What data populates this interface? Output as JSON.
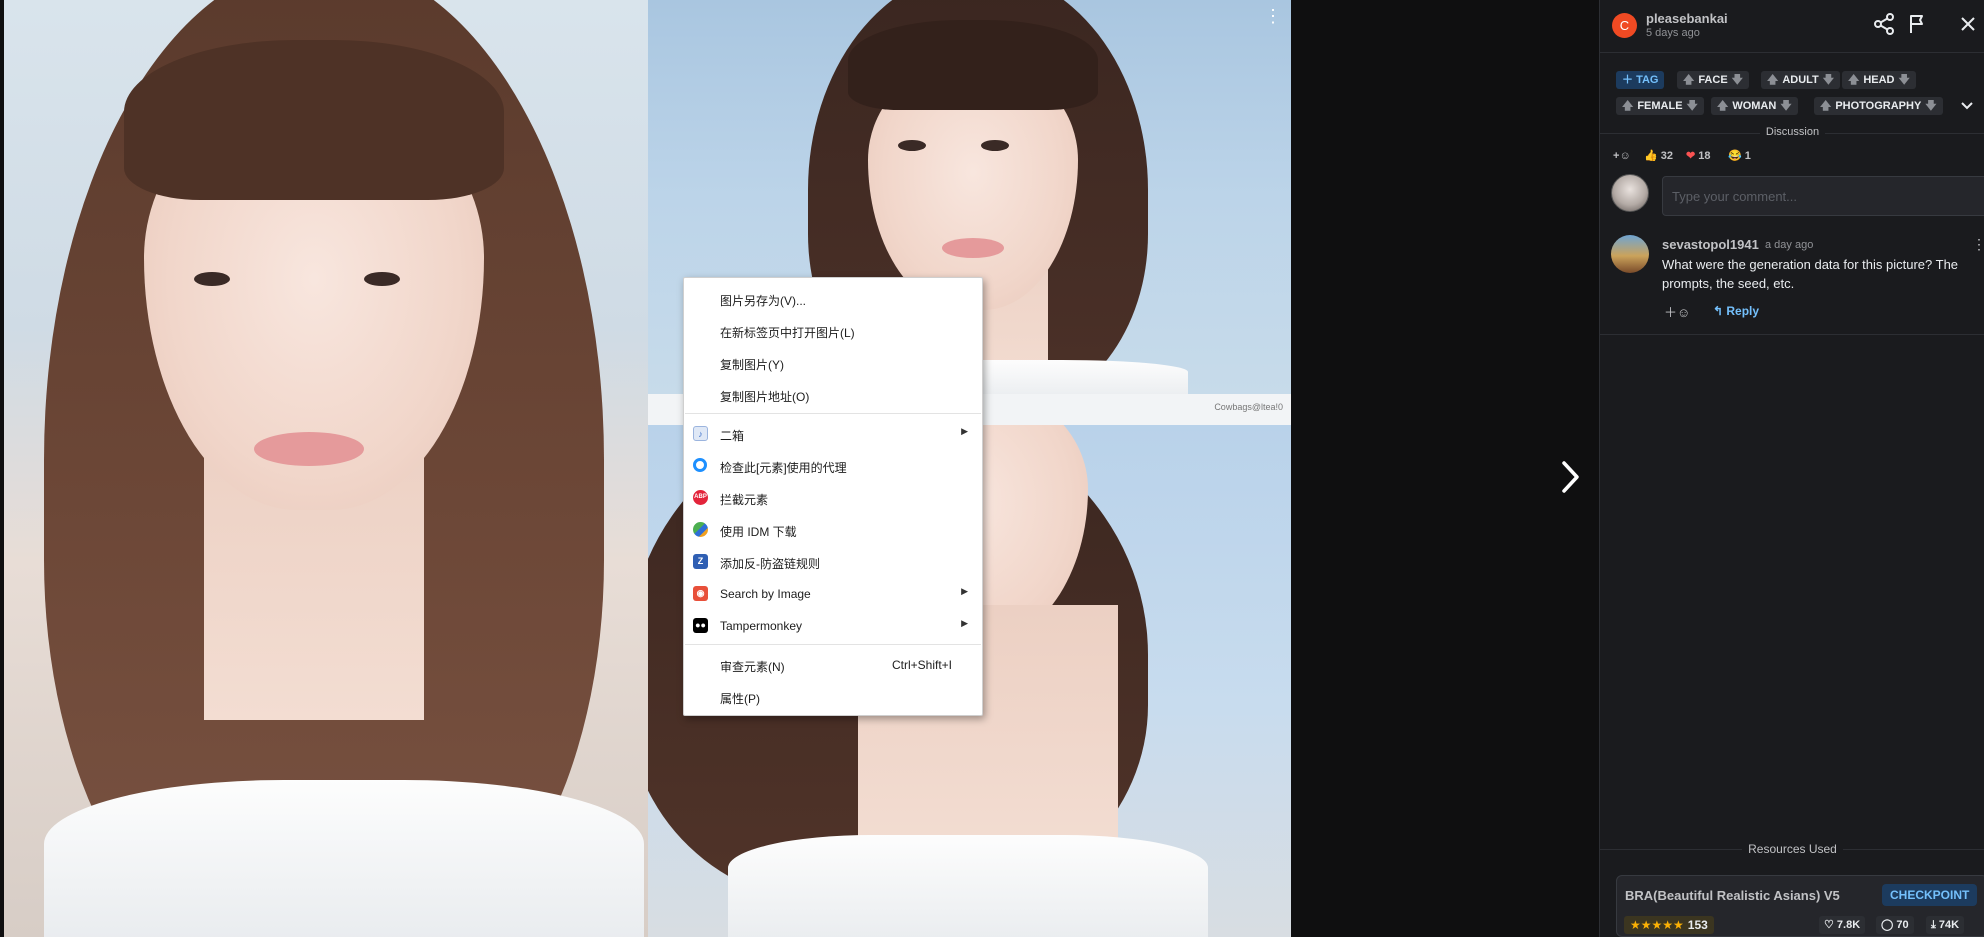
{
  "images": {
    "watermark": "Cowbags@ltea!0"
  },
  "context_menu": {
    "items": [
      {
        "label": "图片另存为(V)...",
        "icon": "",
        "submenu": false
      },
      {
        "label": "在新标签页中打开图片(L)",
        "icon": "",
        "submenu": false
      },
      {
        "label": "复制图片(Y)",
        "icon": "",
        "submenu": false
      },
      {
        "label": "复制图片地址(O)",
        "icon": "",
        "submenu": false
      },
      {
        "label": "二箱",
        "icon": "erxiang-icon",
        "submenu": true
      },
      {
        "label": "检查此[元素]使用的代理",
        "icon": "proxy-circle-icon",
        "submenu": false
      },
      {
        "label": "拦截元素",
        "icon": "adblock-plus-icon",
        "icon_text": "ABP",
        "submenu": false
      },
      {
        "label": "使用 IDM 下载",
        "icon": "idm-icon",
        "submenu": false
      },
      {
        "label": "添加反-防盗链规则",
        "icon": "anti-hotlink-icon",
        "submenu": false
      },
      {
        "label": "Search by Image",
        "icon": "search-by-image-icon",
        "submenu": true
      },
      {
        "label": "Tampermonkey",
        "icon": "tampermonkey-icon",
        "submenu": true
      },
      {
        "label": "审查元素(N)",
        "shortcut": "Ctrl+Shift+I",
        "icon": "",
        "submenu": false
      },
      {
        "label": "属性(P)",
        "icon": "",
        "submenu": false
      }
    ]
  },
  "post": {
    "avatar_letter": "C",
    "username": "pleasebankai",
    "time": "5 days ago"
  },
  "tags": {
    "add_label": "TAG",
    "items": [
      "FACE",
      "ADULT",
      "HEAD",
      "FEMALE",
      "WOMAN",
      "PHOTOGRAPHY"
    ]
  },
  "discussion": {
    "label": "Discussion",
    "reactions": [
      {
        "emoji": "👍",
        "count": "32"
      },
      {
        "emoji": "❤",
        "count": "18"
      },
      {
        "emoji": "😂",
        "count": "1"
      }
    ],
    "comment_placeholder": "Type your comment...",
    "comments": [
      {
        "username": "sevastopol1941",
        "time": "a day ago",
        "text": "What were the generation data for this picture? The prompts, the seed, etc.",
        "reply_label": "Reply"
      }
    ]
  },
  "resources": {
    "label": "Resources Used",
    "items": [
      {
        "name": "BRA(Beautiful Realistic Asians) V5",
        "type": "CHECKPOINT",
        "stars": "★★★★★",
        "rating_count": "153",
        "likes": "7.8K",
        "comments": "70",
        "downloads": "74K"
      }
    ]
  },
  "colors": {
    "sidebar_bg": "#1a1b1e",
    "accent_blue": "#74c0fc",
    "avatar_orange": "#f04a23",
    "heart_red": "#fa5252",
    "star_yellow": "#fab005"
  }
}
